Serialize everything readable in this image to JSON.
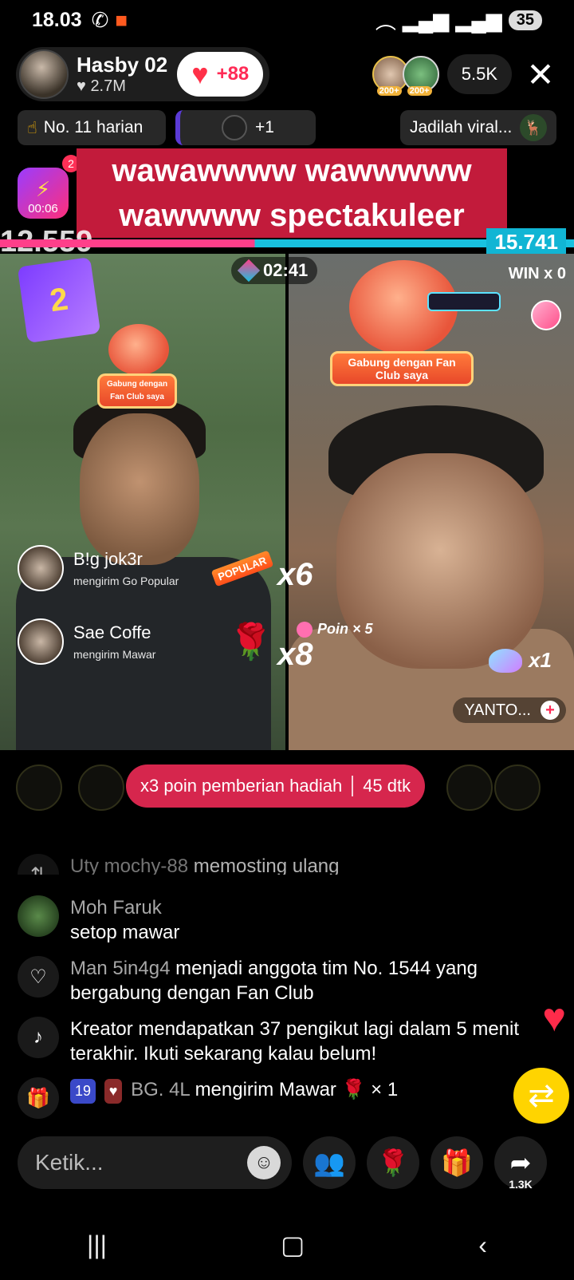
{
  "status": {
    "time": "18.03",
    "battery": "35"
  },
  "host": {
    "name": "Hasby 02",
    "likes": "2.7M",
    "like_bonus": "+88"
  },
  "viewers": {
    "count": "5.5K",
    "tags": [
      "200+",
      "200+"
    ]
  },
  "info": {
    "rank": "No. 11 harian",
    "plus": "+1",
    "viral": "Jadilah viral..."
  },
  "banner": {
    "text": "wawawwww wawwwww wawwww spectakuleer",
    "badge": "2"
  },
  "battle": {
    "timer_small": "00:06",
    "score_left": 12559,
    "score_right": 15741,
    "score_left_text": "12.559",
    "score_right_text": "15.741",
    "countdown": "02:41",
    "win_right": "WIN x 0",
    "fanclub_text": "Gabung dengan Fan Club saya",
    "card_number": "2",
    "combo_left_1": "x6",
    "combo_left_2": "x8",
    "poin_text": "Poin × 5",
    "right_gift_count": "x1",
    "right_user": "YANTO..."
  },
  "gifts": [
    {
      "name": "B!g jok3r",
      "desc": "mengirim Go Popular",
      "tag": "POPULAR"
    },
    {
      "name": "Sae Coffe",
      "desc": "mengirim Mawar"
    }
  ],
  "poin_bar": {
    "text": "x3 poin pemberian hadiah",
    "seconds": "45 dtk"
  },
  "chat": {
    "first": {
      "user": "Uty mochy-88",
      "text": "memosting ulang"
    },
    "items": [
      {
        "user": "Moh Faruk",
        "text": "setop mawar"
      },
      {
        "user": "Man  5in4g4",
        "text": "menjadi anggota tim No. 1544 yang bergabung dengan Fan Club"
      },
      {
        "text": "Kreator mendapatkan 37 pengikut lagi dalam 5 menit terakhir. Ikuti sekarang kalau belum!"
      },
      {
        "badge1": "19",
        "user": "BG. 4L",
        "text": "mengirim Mawar",
        "count": "× 1"
      }
    ]
  },
  "bottom": {
    "placeholder": "Ketik...",
    "share_count": "1.3K"
  },
  "colors": {
    "accent": "#ff2b55",
    "left_team": "#ff3f8a",
    "right_team": "#19c1df",
    "banner": "#c21b3b"
  }
}
